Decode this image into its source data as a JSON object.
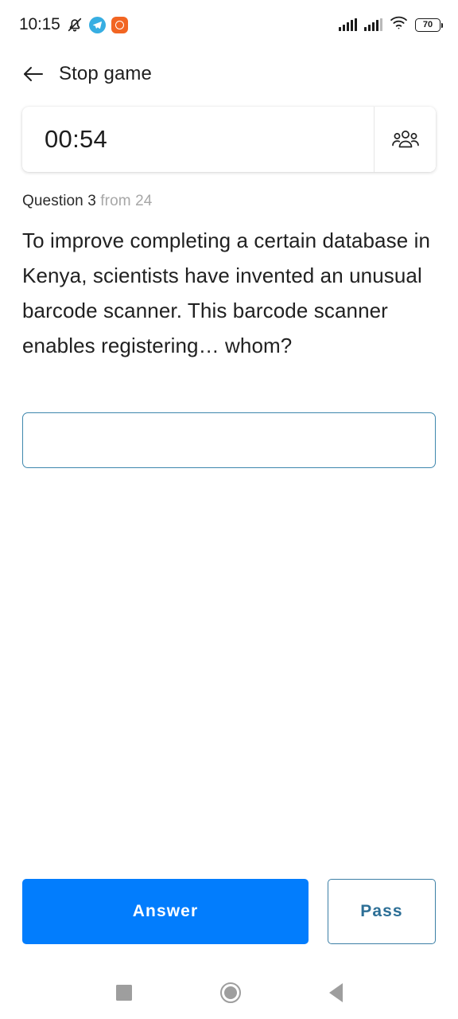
{
  "status_bar": {
    "time": "10:15",
    "battery_level": "70",
    "icons": [
      "mute-bell-icon",
      "telegram-icon",
      "orange-app-icon",
      "signal-bars-icon",
      "signal-bars-secondary-icon",
      "wifi-icon",
      "battery-icon"
    ]
  },
  "topbar": {
    "back_icon": "back-arrow-icon",
    "title": "Stop game"
  },
  "timer": {
    "value": "00:54",
    "players_icon": "group-people-icon"
  },
  "question": {
    "label": "Question 3",
    "total": "from 24",
    "text": "To improve completing a certain database in Kenya, scientists have invented an unusual barcode scanner. This barcode scanner enables registering… whom?"
  },
  "answer_field": {
    "value": "",
    "placeholder": ""
  },
  "actions": {
    "answer_label": "Answer",
    "pass_label": "Pass"
  },
  "navbar": {
    "recents": "square-recents-icon",
    "home": "circle-home-icon",
    "back": "triangle-back-icon"
  },
  "colors": {
    "accent_blue": "#027DFD",
    "input_border": "#3E87AD",
    "pass_text": "#2D6F96",
    "muted_text": "#A7A7A7",
    "nav_gray": "#9E9E9E"
  }
}
